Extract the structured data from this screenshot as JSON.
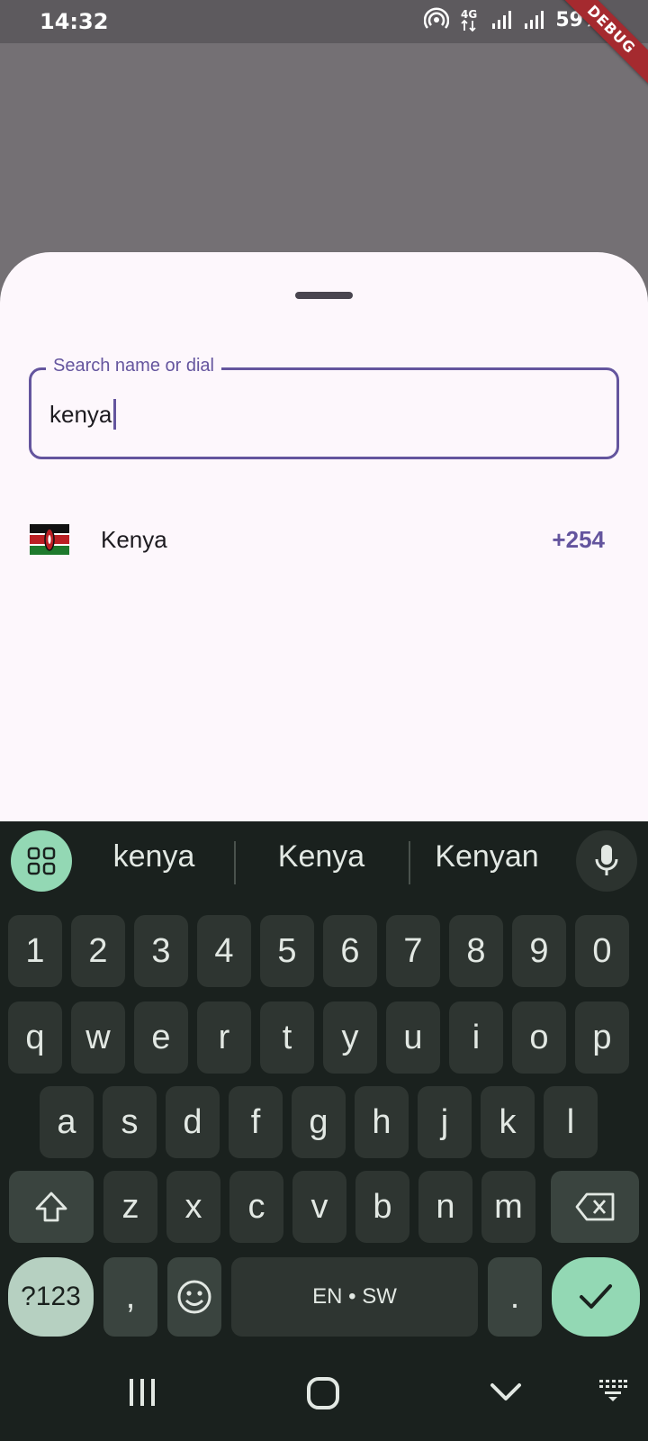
{
  "status_bar": {
    "time": "14:32",
    "battery": "59%",
    "debug_banner": "DEBUG"
  },
  "sheet": {
    "search": {
      "label": "Search name or dial",
      "value": "kenya"
    },
    "results": [
      {
        "country": "Kenya",
        "dial_code": "+254",
        "flag_icon": "kenya-flag-icon"
      }
    ]
  },
  "keyboard": {
    "suggestions": [
      "kenya",
      "Kenya",
      "Kenyan"
    ],
    "row_numbers": [
      "1",
      "2",
      "3",
      "4",
      "5",
      "6",
      "7",
      "8",
      "9",
      "0"
    ],
    "row_top": [
      "q",
      "w",
      "e",
      "r",
      "t",
      "y",
      "u",
      "i",
      "o",
      "p"
    ],
    "row_middle": [
      "a",
      "s",
      "d",
      "f",
      "g",
      "h",
      "j",
      "k",
      "l"
    ],
    "row_bottom": [
      "z",
      "x",
      "c",
      "v",
      "b",
      "n",
      "m"
    ],
    "symbols_label": "?123",
    "comma": ",",
    "space_label": "EN • SW",
    "period": "."
  },
  "colors": {
    "accent": "#64559e",
    "sheet_bg": "#fdf7fc",
    "keyboard_bg": "#1a211e",
    "key_bg": "#2e3531",
    "enter_bg": "#93d8b4"
  }
}
